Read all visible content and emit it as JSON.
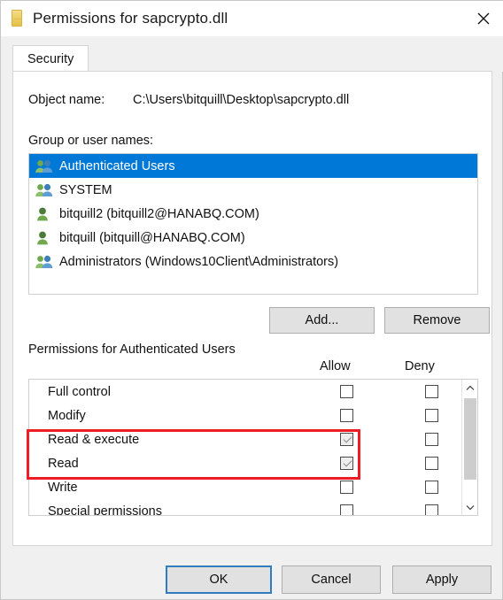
{
  "window": {
    "title": "Permissions for sapcrypto.dll",
    "icon": "file-dll-icon",
    "close_label": "✕"
  },
  "tabs": [
    {
      "label": "Security",
      "active": true
    }
  ],
  "object": {
    "label": "Object name:",
    "value": "C:\\Users\\bitquill\\Desktop\\sapcrypto.dll"
  },
  "group_section": {
    "label": "Group or user names:",
    "items": [
      {
        "name": "Authenticated Users",
        "icon": "group-icon",
        "selected": true
      },
      {
        "name": "SYSTEM",
        "icon": "group-icon",
        "selected": false
      },
      {
        "name": "bitquill2 (bitquill2@HANABQ.COM)",
        "icon": "user-icon",
        "selected": false
      },
      {
        "name": "bitquill (bitquill@HANABQ.COM)",
        "icon": "user-icon",
        "selected": false
      },
      {
        "name": "Administrators (Windows10Client\\Administrators)",
        "icon": "group-icon",
        "selected": false
      }
    ],
    "add_label": "Add...",
    "remove_label": "Remove"
  },
  "permissions_section": {
    "label": "Permissions for Authenticated Users",
    "allow_header": "Allow",
    "deny_header": "Deny",
    "rows": [
      {
        "name": "Full control",
        "allow": false,
        "deny": false,
        "highlighted": false
      },
      {
        "name": "Modify",
        "allow": false,
        "deny": false,
        "highlighted": false
      },
      {
        "name": "Read & execute",
        "allow": true,
        "deny": false,
        "highlighted": true
      },
      {
        "name": "Read",
        "allow": true,
        "deny": false,
        "highlighted": true
      },
      {
        "name": "Write",
        "allow": false,
        "deny": false,
        "highlighted": false
      },
      {
        "name": "Special permissions",
        "allow": false,
        "deny": false,
        "highlighted": false
      }
    ],
    "scroll_up_icon": "chevron-up-icon",
    "scroll_down_icon": "chevron-down-icon"
  },
  "footer": {
    "ok_label": "OK",
    "cancel_label": "Cancel",
    "apply_label": "Apply"
  },
  "colors": {
    "selection": "#0078d7",
    "highlight": "#ee1c24",
    "focus_border": "#2f7cc0",
    "button_face": "#e1e1e1"
  }
}
